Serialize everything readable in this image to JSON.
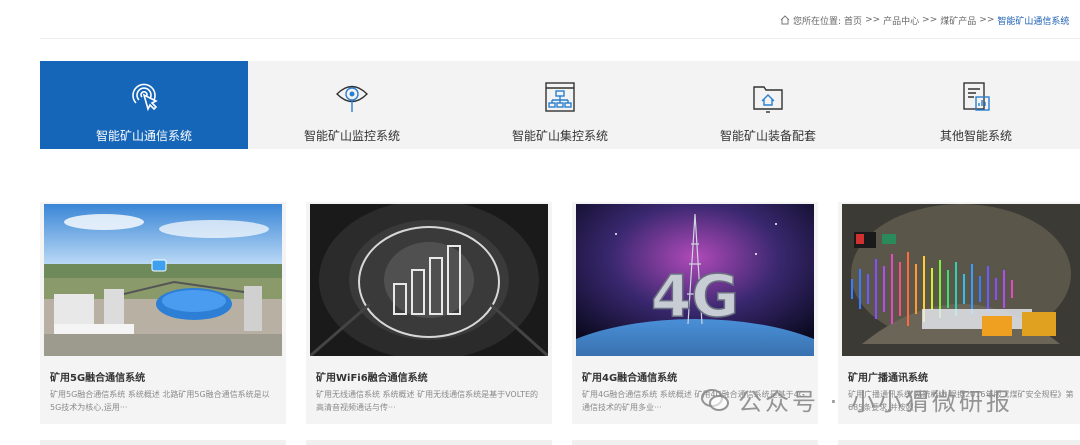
{
  "breadcrumb": {
    "prefix": "您所在位置:",
    "items": [
      "首页",
      "产品中心",
      "煤矿产品"
    ],
    "separator": ">>",
    "current": "智能矿山通信系统"
  },
  "tabs": [
    {
      "label": "智能矿山通信系统",
      "icon": "signal-touch-icon",
      "active": true
    },
    {
      "label": "智能矿山监控系统",
      "icon": "eye-icon",
      "active": false
    },
    {
      "label": "智能矿山集控系统",
      "icon": "control-panel-icon",
      "active": false
    },
    {
      "label": "智能矿山装备配套",
      "icon": "folder-home-icon",
      "active": false
    },
    {
      "label": "其他智能系统",
      "icon": "document-chart-icon",
      "active": false
    }
  ],
  "cards": [
    {
      "title": "矿用5G融合通信系统",
      "desc": "矿用5G融合通信系统 系统概述 北路矿用5G融合通信系统是以5G技术为核心,运用···",
      "image": "mine-site-5g-photo"
    },
    {
      "title": "矿用WiFi6融合通信系统",
      "desc": "矿用无线通信系统 系统概述 矿用无线通信系统是基于VOLTE的高清音视频通话与传···",
      "image": "tunnel-signal-bars-photo"
    },
    {
      "title": "矿用4G融合通信系统",
      "desc": "矿用4G融合通信系统 系统概述 矿用4G融合通信系统是基于4G通信技术的矿用多业···",
      "image": "4g-tower-earth-photo"
    },
    {
      "title": "矿用广播通讯系统",
      "desc": "矿用广播通讯系统 系统概述 根据2016年版《煤矿安全规程》第685条要求,并按照···",
      "image": "broadcast-soundwave-photo"
    }
  ],
  "watermark": {
    "text": "公众号 · 小小猬微研报",
    "icon": "wechat-icon"
  },
  "colors": {
    "accent": "#1565b8",
    "tab_bg": "#f3f3f3",
    "card_bg": "#f4f4f4"
  }
}
